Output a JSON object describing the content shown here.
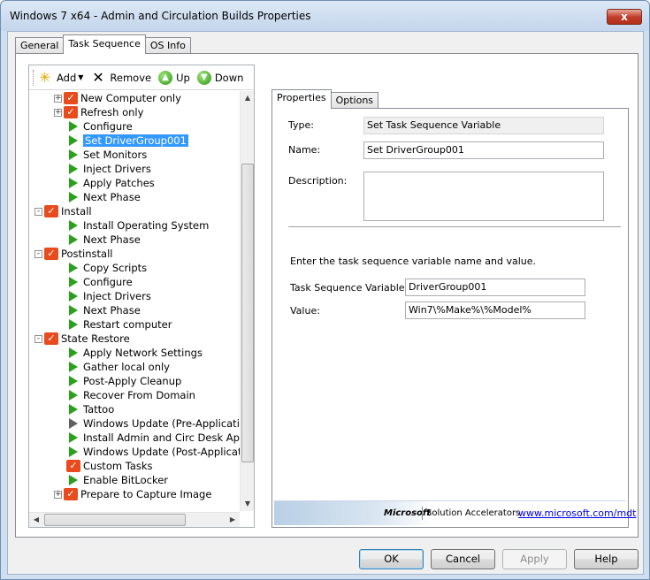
{
  "window": {
    "title": "Windows 7 x64 - Admin and Circulation Builds Properties",
    "close": "x"
  },
  "tabs": [
    "General",
    "Task Sequence",
    "OS Info"
  ],
  "toolbar": {
    "add": "Add",
    "remove": "Remove",
    "up": "Up",
    "down": "Down"
  },
  "tree": [
    {
      "label": "New Computer only",
      "level": 1,
      "icon": "checklist",
      "expander": "+"
    },
    {
      "label": "Refresh only",
      "level": 1,
      "icon": "checklist",
      "expander": "+"
    },
    {
      "label": "Configure",
      "level": 2,
      "icon": "play"
    },
    {
      "label": "Set DriverGroup001",
      "level": 2,
      "icon": "play",
      "selected": true
    },
    {
      "label": "Set Monitors",
      "level": 2,
      "icon": "play"
    },
    {
      "label": "Inject Drivers",
      "level": 2,
      "icon": "play"
    },
    {
      "label": "Apply Patches",
      "level": 2,
      "icon": "play"
    },
    {
      "label": "Next Phase",
      "level": 2,
      "icon": "play"
    },
    {
      "label": "Install",
      "level": 0,
      "icon": "checklist",
      "expander": "-"
    },
    {
      "label": "Install Operating System",
      "level": 2,
      "icon": "play"
    },
    {
      "label": "Next Phase",
      "level": 2,
      "icon": "play"
    },
    {
      "label": "Postinstall",
      "level": 0,
      "icon": "checklist",
      "expander": "-"
    },
    {
      "label": "Copy Scripts",
      "level": 2,
      "icon": "play"
    },
    {
      "label": "Configure",
      "level": 2,
      "icon": "play"
    },
    {
      "label": "Inject Drivers",
      "level": 2,
      "icon": "play"
    },
    {
      "label": "Next Phase",
      "level": 2,
      "icon": "play"
    },
    {
      "label": "Restart computer",
      "level": 2,
      "icon": "play"
    },
    {
      "label": "State Restore",
      "level": 0,
      "icon": "checklist",
      "expander": "-"
    },
    {
      "label": "Apply Network Settings",
      "level": 2,
      "icon": "play"
    },
    {
      "label": "Gather local only",
      "level": 2,
      "icon": "play"
    },
    {
      "label": "Post-Apply Cleanup",
      "level": 2,
      "icon": "play"
    },
    {
      "label": "Recover From Domain",
      "level": 2,
      "icon": "play"
    },
    {
      "label": "Tattoo",
      "level": 2,
      "icon": "play"
    },
    {
      "label": "Windows Update (Pre-Application Ins",
      "level": 2,
      "icon": "play-grey"
    },
    {
      "label": "Install Admin and Circ Desk Applicatio",
      "level": 2,
      "icon": "play"
    },
    {
      "label": "Windows Update (Post-Application Ins",
      "level": 2,
      "icon": "play"
    },
    {
      "label": "Custom Tasks",
      "level": 2,
      "icon": "checklist"
    },
    {
      "label": "Enable BitLocker",
      "level": 2,
      "icon": "play"
    },
    {
      "label": "Prepare to Capture Image",
      "level": 1,
      "icon": "checklist",
      "expander": "+"
    }
  ],
  "right_tabs": [
    "Properties",
    "Options"
  ],
  "props": {
    "type_label": "Type:",
    "type_value": "Set Task Sequence Variable",
    "name_label": "Name:",
    "name_value": "Set DriverGroup001",
    "desc_label": "Description:",
    "desc_value": "",
    "instruction": "Enter the task sequence variable name and value.",
    "var_label": "Task Sequence Variable:",
    "var_value": "DriverGroup001",
    "value_label": "Value:",
    "value_value": "Win7\\%Make%\\%Model%"
  },
  "footer": {
    "brand": "Microsoft",
    "product": "Solution Accelerators",
    "link": "www.microsoft.com/mdt"
  },
  "buttons": {
    "ok": "OK",
    "cancel": "Cancel",
    "apply": "Apply",
    "help": "Help"
  },
  "colors": {
    "selection": "#3399ff",
    "play_icon": "#2aa01c",
    "checklist_icon": "#e84c1e",
    "close_button": "#c2402c"
  }
}
